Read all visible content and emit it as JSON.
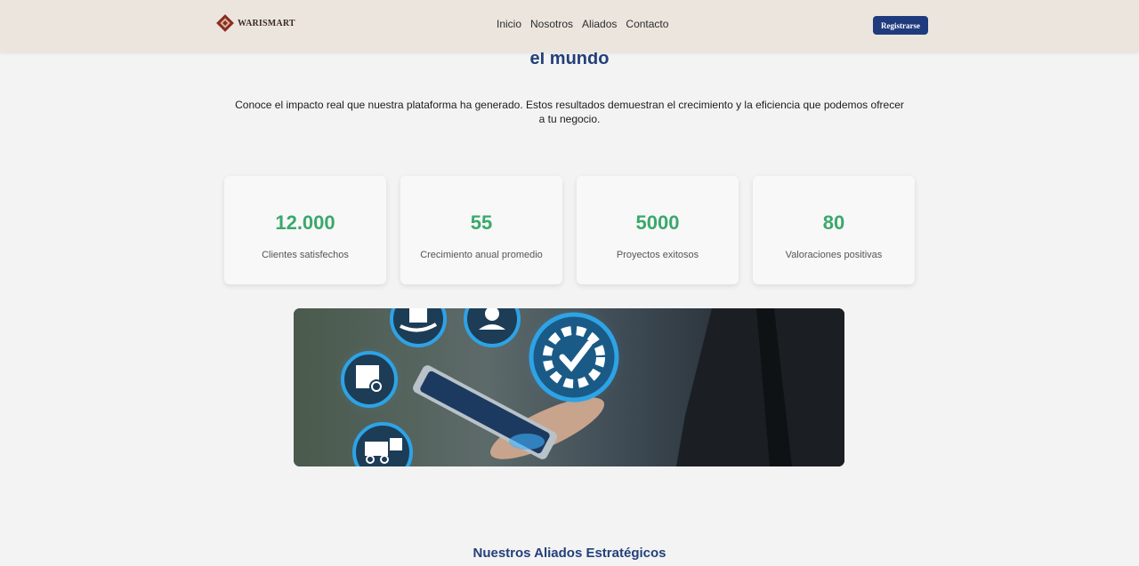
{
  "nav": {
    "brand": "WARISMART",
    "links": [
      "Inicio",
      "Nosotros",
      "Aliados",
      "Contacto"
    ],
    "register_label": "Registrarse"
  },
  "hero": {
    "title_tail": "el mundo",
    "intro": "Conoce el impacto real que nuestra plataforma ha generado. Estos resultados demuestran el crecimiento y la eficiencia que podemos ofrecer a tu negocio."
  },
  "stats": [
    {
      "value": "12.000",
      "label": "Clientes satisfechos"
    },
    {
      "value": "55",
      "label": "Crecimiento anual promedio"
    },
    {
      "value": "5000",
      "label": "Proyectos exitosos"
    },
    {
      "value": "80",
      "label": "Valoraciones positivas"
    }
  ],
  "banner": {
    "icons": [
      "package-return-icon",
      "hand-box-icon",
      "worker-icon",
      "gear-check-icon",
      "forklift-icon"
    ]
  },
  "allies": {
    "title": "Nuestros Aliados Estratégicos"
  },
  "colors": {
    "navbar_bg": "#ebe5de",
    "brand_blue": "#1f3b7e",
    "heading_blue": "#23407a",
    "stat_green": "#3ba86b",
    "page_bg": "#f3f3f3"
  }
}
